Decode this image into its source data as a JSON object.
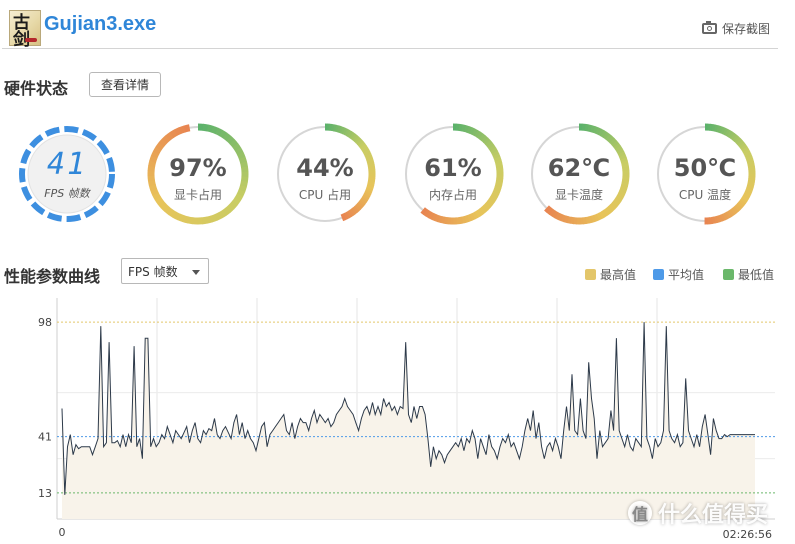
{
  "window": {
    "title": "Gujian3.exe",
    "icon_text": "古剑",
    "screenshot_label": "保存截图"
  },
  "hardware": {
    "section_title": "硬件状态",
    "details_button": "查看详情"
  },
  "gauges": {
    "fps": {
      "value": "41",
      "label": "FPS 帧数",
      "color": "#3d8fe0"
    },
    "items": [
      {
        "value": "97%",
        "label": "显卡占用",
        "percent": 97
      },
      {
        "value": "44%",
        "label": "CPU 占用",
        "percent": 44
      },
      {
        "value": "61%",
        "label": "内存占用",
        "percent": 61
      },
      {
        "value": "62℃",
        "label": "显卡温度",
        "percent": 62
      },
      {
        "value": "50℃",
        "label": "CPU 温度",
        "percent": 50
      }
    ]
  },
  "performance": {
    "section_title": "性能参数曲线",
    "dropdown_value": "FPS 帧数",
    "legend": [
      {
        "label": "最高值",
        "color": "#e3c66a"
      },
      {
        "label": "平均值",
        "color": "#4e9ae8"
      },
      {
        "label": "最低值",
        "color": "#6bb86b"
      }
    ]
  },
  "chart_data": {
    "type": "line",
    "y_ticks": [
      "98",
      "41",
      "13"
    ],
    "x_start_label": "0",
    "x_end_label": "02:26:56",
    "max_line": 98,
    "avg_line": 41,
    "min_line": 13,
    "ylim": [
      0,
      110
    ],
    "series": [
      {
        "values": [
          55,
          12,
          36,
          42,
          32,
          37,
          35,
          36,
          36,
          36,
          36,
          32,
          36,
          40,
          96,
          36,
          38,
          88,
          38,
          38,
          39,
          36,
          42,
          36,
          42,
          38,
          86,
          36,
          40,
          30,
          90,
          90,
          36,
          40,
          36,
          38,
          42,
          40,
          46,
          42,
          38,
          44,
          42,
          40,
          43,
          46,
          38,
          44,
          48,
          40,
          38,
          44,
          42,
          45,
          44,
          50,
          42,
          40,
          44,
          46,
          43,
          40,
          48,
          52,
          42,
          48,
          40,
          44,
          40,
          38,
          34,
          40,
          46,
          48,
          36,
          42,
          44,
          46,
          48,
          50,
          52,
          44,
          42,
          48,
          40,
          46,
          50,
          48,
          48,
          44,
          50,
          54,
          48,
          52,
          50,
          48,
          50,
          46,
          48,
          52,
          54,
          56,
          60,
          56,
          54,
          52,
          48,
          44,
          50,
          54,
          56,
          52,
          58,
          52,
          56,
          52,
          60,
          56,
          58,
          54,
          56,
          52,
          56,
          55,
          88,
          52,
          48,
          56,
          50,
          56,
          56,
          52,
          40,
          26,
          36,
          30,
          34,
          32,
          28,
          32,
          34,
          36,
          38,
          36,
          40,
          34,
          40,
          38,
          44,
          40,
          30,
          40,
          36,
          32,
          42,
          36,
          34,
          30,
          36,
          40,
          38,
          42,
          36,
          38,
          34,
          30,
          36,
          44,
          50,
          44,
          54,
          40,
          48,
          36,
          30,
          36,
          38,
          34,
          40,
          36,
          30,
          44,
          56,
          44,
          72,
          44,
          42,
          60,
          44,
          40,
          78,
          60,
          50,
          30,
          44,
          36,
          38,
          40,
          54,
          44,
          90,
          44,
          40,
          36,
          42,
          36,
          34,
          40,
          38,
          36,
          98,
          40,
          36,
          30,
          40,
          36,
          38,
          44,
          96,
          44,
          40,
          38,
          42,
          36,
          38,
          70,
          44,
          40,
          36,
          42,
          36,
          46,
          52,
          42,
          32,
          50,
          44,
          40,
          40,
          42,
          41,
          42,
          42,
          42,
          42,
          42,
          42,
          42,
          42,
          42,
          42
        ]
      }
    ]
  }
}
